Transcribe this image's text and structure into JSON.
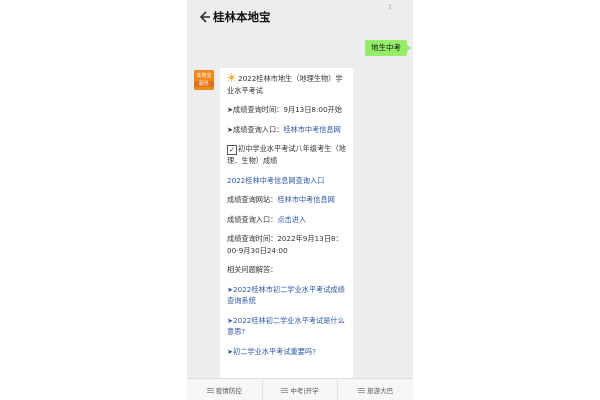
{
  "header": {
    "title": "桂林本地宝",
    "back_icon": "back-arrow-icon",
    "mini_icon": "ellipsis-icon"
  },
  "user_message": "地生中考",
  "avatar": {
    "line1": "本地宝",
    "line2": "服务"
  },
  "message": {
    "heading": "2022桂林市地生（地理生物）学业水平考试",
    "line_query_time": "➤成绩查询时间：9月13日8:00开始",
    "entrance_label": "➤成绩查询入口：",
    "entrance_link": "桂林市中考信息网",
    "check_text": "初中学业水平考试八年级考生（地理、生物）成绩",
    "query_link": "2022桂林中考信息网查询入口",
    "website_label": "成绩查询网站：",
    "website_link": "桂林市中考信息网",
    "entry2_label": "成绩查询入口：",
    "entry2_link": "点击进入",
    "time2": "成绩查询时间：2022年9月13日8：00-9月30日24:00",
    "faq_title": "相关问题解答：",
    "faq1": "➤2022桂林市初二学业水平考试成绩查询系统",
    "faq2": "➤2022桂林初二学业水平考试是什么意思?",
    "faq3": "➤初二学业水平考试重要吗?"
  },
  "bottom_menu": [
    {
      "label": "疫情防控",
      "icon": "menu-lines-icon"
    },
    {
      "label": "中考|开学",
      "icon": "menu-lines-icon"
    },
    {
      "label": "旅游大巴",
      "icon": "menu-lines-icon"
    }
  ],
  "colors": {
    "user_bubble": "#95ec69",
    "link": "#2b57a6",
    "avatar": "#f08a1c",
    "background": "#ededed"
  }
}
